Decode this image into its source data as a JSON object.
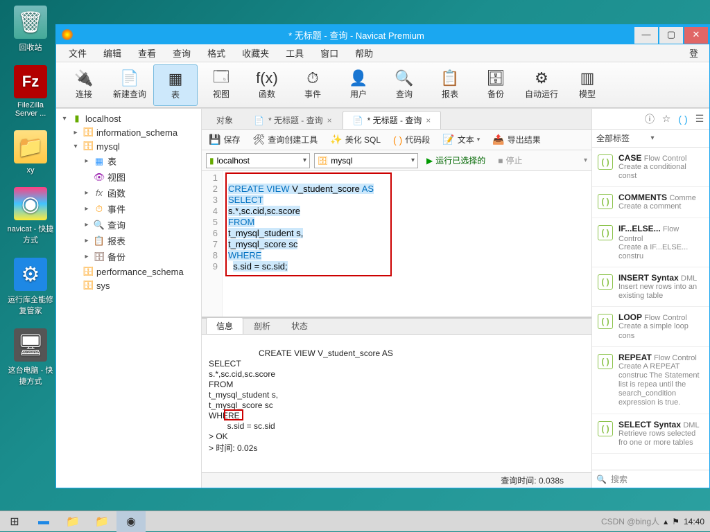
{
  "desktop_icons": [
    {
      "key": "recycle",
      "label": "回收站"
    },
    {
      "key": "fz",
      "label": "FileZilla Server ..."
    },
    {
      "key": "folder",
      "label": "xy"
    },
    {
      "key": "navi",
      "label": "navicat - 快捷方式"
    },
    {
      "key": "fix",
      "label": "运行库全能修复管家"
    },
    {
      "key": "pc",
      "label": "这台电脑 - 快捷方式"
    }
  ],
  "taskbar": {
    "time": "14:40",
    "watermark": "CSDN @bing人"
  },
  "window": {
    "title": "* 无标题 - 查询 - Navicat Premium",
    "menus": [
      "文件",
      "编辑",
      "查看",
      "查询",
      "格式",
      "收藏夹",
      "工具",
      "窗口",
      "帮助"
    ],
    "menu_right": "登",
    "tools": [
      {
        "label": "连接",
        "icon": "🔌"
      },
      {
        "label": "新建查询",
        "icon": "📄"
      },
      {
        "label": "表",
        "icon": "▦",
        "active": true
      },
      {
        "label": "视图",
        "icon": "🗔"
      },
      {
        "label": "函数",
        "icon": "f(x)"
      },
      {
        "label": "事件",
        "icon": "⏱"
      },
      {
        "label": "用户",
        "icon": "👤"
      },
      {
        "label": "查询",
        "icon": "🔍"
      },
      {
        "label": "报表",
        "icon": "📋"
      },
      {
        "label": "备份",
        "icon": "🗄"
      },
      {
        "label": "自动运行",
        "icon": "⚙"
      },
      {
        "label": "模型",
        "icon": "▥"
      }
    ]
  },
  "tree": [
    {
      "t": "▾",
      "ico": "srv",
      "label": "localhost",
      "cls": ""
    },
    {
      "t": "▸",
      "ico": "db",
      "label": "information_schema",
      "cls": "indent1"
    },
    {
      "t": "▾",
      "ico": "db",
      "label": "mysql",
      "cls": "indent1"
    },
    {
      "t": "▸",
      "ico": "tbl",
      "label": "表",
      "cls": "indent2"
    },
    {
      "t": "",
      "ico": "view",
      "label": "视图",
      "cls": "indent2"
    },
    {
      "t": "▸",
      "ico": "fx",
      "label": "函数",
      "cls": "indent2"
    },
    {
      "t": "▸",
      "ico": "evt",
      "label": "事件",
      "cls": "indent2"
    },
    {
      "t": "▸",
      "ico": "qry",
      "label": "查询",
      "cls": "indent2"
    },
    {
      "t": "▸",
      "ico": "rpt",
      "label": "报表",
      "cls": "indent2"
    },
    {
      "t": "▸",
      "ico": "bak",
      "label": "备份",
      "cls": "indent2"
    },
    {
      "t": "",
      "ico": "db",
      "label": "performance_schema",
      "cls": "indent1"
    },
    {
      "t": "",
      "ico": "db",
      "label": "sys",
      "cls": "indent1"
    }
  ],
  "tabs": [
    {
      "label": "对象",
      "active": false
    },
    {
      "label": "* 无标题 - 查询",
      "active": false,
      "icon": "📄"
    },
    {
      "label": "* 无标题 - 查询",
      "active": true,
      "icon": "📄"
    }
  ],
  "qtool": {
    "save": "保存",
    "builder": "查询创建工具",
    "beauty": "美化 SQL",
    "snip": "代码段",
    "text": "文本",
    "export": "导出结果"
  },
  "conn": {
    "host": "localhost",
    "db": "mysql",
    "run": "运行已选择的",
    "stop": "停止"
  },
  "code_lines": [
    {
      "n": 1,
      "html": ""
    },
    {
      "n": 2,
      "html": "<span class='hl'><span class='kw'>CREATE</span> <span class='kw'>VIEW</span> V_student_score <span class='kw'>AS</span></span>"
    },
    {
      "n": 3,
      "html": "<span class='hl'><span class='kw'>SELECT</span></span>"
    },
    {
      "n": 4,
      "html": "<span class='hl'>s.*,sc.cid,sc.score</span>"
    },
    {
      "n": 5,
      "html": "<span class='hl'><span class='kw'>FROM</span></span>"
    },
    {
      "n": 6,
      "html": "<span class='hl'>t_mysql_student s,</span>"
    },
    {
      "n": 7,
      "html": "<span class='hl'>t_mysql_score sc</span>"
    },
    {
      "n": 8,
      "html": "<span class='hl'><span class='kw'>WHERE</span></span>"
    },
    {
      "n": 9,
      "html": "  <span class='hl'>s.sid = sc.sid;</span>"
    }
  ],
  "out_tabs": [
    "信息",
    "剖析",
    "状态"
  ],
  "output_text": "CREATE VIEW V_student_score AS\nSELECT\ns.*,sc.cid,sc.score\nFROM\nt_mysql_student s,\nt_mysql_score sc\nWHERE\n        s.sid = sc.sid\n> OK\n> 时间: 0.02s",
  "status": "查询时间: 0.038s",
  "rp": {
    "filter": "全部标签",
    "search": "搜索",
    "items": [
      {
        "t": "CASE",
        "tag": "Flow Control",
        "d": "Create a conditional const"
      },
      {
        "t": "COMMENTS",
        "tag": "Comme",
        "d": "Create a comment"
      },
      {
        "t": "IF...ELSE...",
        "tag": "Flow Control",
        "d": "Create a IF...ELSE... constru"
      },
      {
        "t": "INSERT Syntax",
        "tag": "DML",
        "d": "Insert new rows into an existing table"
      },
      {
        "t": "LOOP",
        "tag": "Flow Control",
        "d": "Create a simple loop cons"
      },
      {
        "t": "REPEAT",
        "tag": "Flow Control",
        "d": "Create A REPEAT construc The Statement list is repea until the search_condition expression is true."
      },
      {
        "t": "SELECT Syntax",
        "tag": "DML",
        "d": "Retrieve rows selected fro one or more tables"
      }
    ]
  }
}
